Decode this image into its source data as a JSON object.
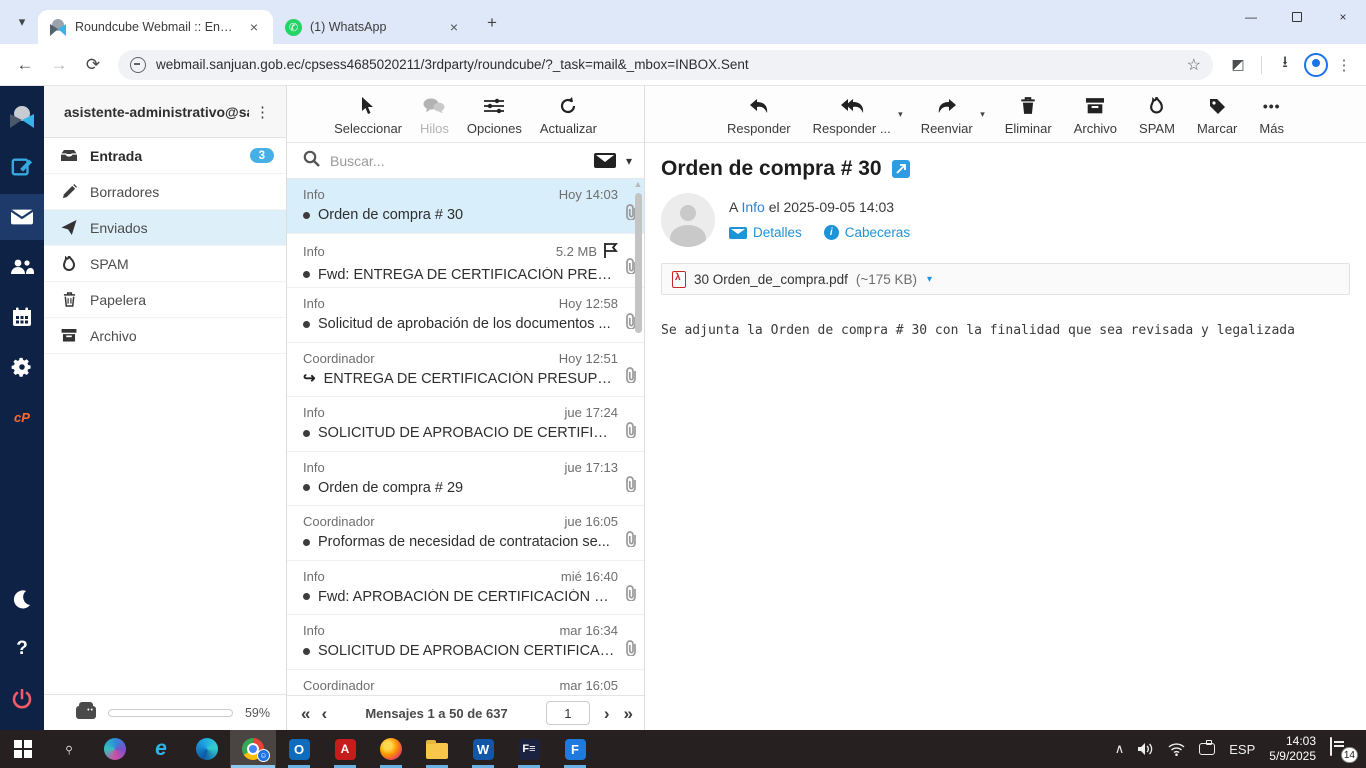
{
  "browser": {
    "tabs": [
      {
        "title": "Roundcube Webmail :: Enviados"
      },
      {
        "title": "(1) WhatsApp"
      }
    ],
    "url": "webmail.sanjuan.gob.ec/cpsess4685020211/3rdparty/roundcube/?_task=mail&_mbox=INBOX.Sent",
    "new_tab_glyph": "+",
    "tab_search_glyph": "▾",
    "close_glyph": "×",
    "minimize_glyph": "—",
    "back_glyph": "←",
    "forward_glyph": "→",
    "reload_glyph": "⟳",
    "star_glyph": "☆",
    "download_glyph": "⭳",
    "kebab_glyph": "⋮"
  },
  "sidebar": {
    "account": "asistente-administrativo@sa...",
    "kebab_glyph": "⋮",
    "folders": [
      {
        "label": "Entrada",
        "count": "3"
      },
      {
        "label": "Borradores"
      },
      {
        "label": "Enviados"
      },
      {
        "label": "SPAM"
      },
      {
        "label": "Papelera"
      },
      {
        "label": "Archivo"
      }
    ],
    "quota": "59%",
    "quota_percent": 59
  },
  "list_toolbar": {
    "select": "Seleccionar",
    "threads": "Hilos",
    "options": "Opciones",
    "refresh": "Actualizar"
  },
  "search": {
    "placeholder": "Buscar...",
    "scope_chevron": "▾"
  },
  "messages": [
    {
      "from": "Info",
      "date": "Hoy 14:03",
      "subject": "Orden de compra # 30"
    },
    {
      "from": "Info",
      "date": "5.2 MB",
      "subject": "Fwd: ENTREGA DE CERTIFICACIÓN PRESUP..."
    },
    {
      "from": "Info",
      "date": "Hoy 12:58",
      "subject": "Solicitud de aprobación de los documentos ..."
    },
    {
      "from": "Coordinador",
      "date": "Hoy 12:51",
      "subject": "ENTREGA DE CERTIFICACIÓN PRESUPUEST..."
    },
    {
      "from": "Info",
      "date": "jue 17:24",
      "subject": "SOLICITUD DE APROBACIO DE CERTIFICACI..."
    },
    {
      "from": "Info",
      "date": "jue 17:13",
      "subject": "Orden de compra # 29"
    },
    {
      "from": "Coordinador",
      "date": "jue 16:05",
      "subject": "Proformas de necesidad de contratacion se..."
    },
    {
      "from": "Info",
      "date": "mié 16:40",
      "subject": "Fwd: APROBACIÓN DE CERTIFICACIÓN PRE..."
    },
    {
      "from": "Info",
      "date": "mar 16:34",
      "subject": "SOLICITUD DE APROBACION CERTIFICACIO..."
    },
    {
      "from": "Coordinador",
      "date": "mar 16:05",
      "subject": ""
    }
  ],
  "pagination": {
    "first": "«",
    "prev": "‹",
    "next": "›",
    "last": "»",
    "text": "Mensajes 1 a 50 de 637",
    "page": "1"
  },
  "view_toolbar": {
    "reply": "Responder",
    "reply_all": "Responder ...",
    "forward": "Reenviar",
    "delete": "Eliminar",
    "archive": "Archivo",
    "spam": "SPAM",
    "mark": "Marcar",
    "more": "Más",
    "more_glyph": "•••",
    "caret_glyph": "▾"
  },
  "message": {
    "subject": "Orden de compra # 30",
    "meta_to_prefix": "A",
    "meta_to": "Info",
    "meta_mid": "el",
    "meta_date": "2025-09-05 14:03",
    "details_label": "Detalles",
    "headers_label": "Cabeceras",
    "info_glyph": "i",
    "attachment_name": "30 Orden_de_compra.pdf",
    "attachment_size": "(~175 KB)",
    "attachment_caret": "▾",
    "body": "Se adjunta la Orden de compra # 30 con la finalidad que sea revisada y legalizada"
  },
  "taskbar": {
    "tray_chevron": "∧",
    "language": "ESP",
    "time": "14:03",
    "date": "5/9/2025",
    "notification_count": "14",
    "outlook_letter": "O",
    "acrobat_letter": "A",
    "word_letter": "W",
    "fes_letter": "F≡",
    "fapp_letter": "F",
    "ie_letter": "e",
    "chrome_badge_glyph": "☺"
  },
  "colors": {
    "accent_blue": "#46b0e6",
    "link_blue": "#1d93d8",
    "rail_navy": "#0e2245",
    "selected_row": "#d8eefa",
    "taskbar_dark": "#262120"
  }
}
